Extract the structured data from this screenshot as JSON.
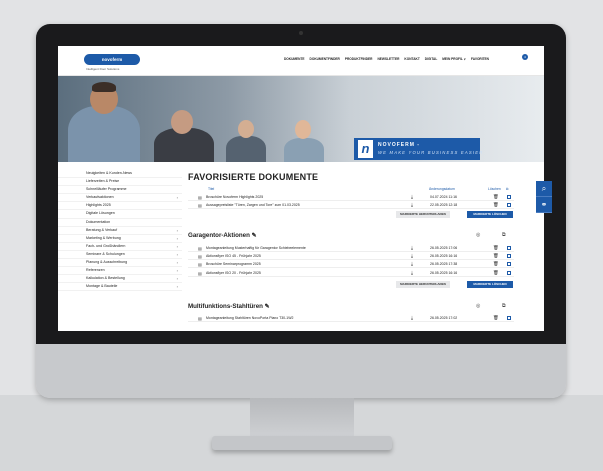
{
  "site": {
    "logo_text": "novoferm",
    "tagline": "Intelligent Door Solutions"
  },
  "nav": {
    "items": [
      "DOKUMENTE",
      "DOKUMENTFINDER",
      "PRODUKTFINDER",
      "NEWSLETTER",
      "KONTAKT",
      "DIGITAL",
      "MEIN PROFIL ∨",
      "FAVORITEN"
    ],
    "favorites_count": "4"
  },
  "hero": {
    "logo_letter": "n",
    "brand": "NOVOFERM -",
    "slogan": "WE MAKE YOUR BUSINESS EASIER"
  },
  "sidebar": {
    "items": [
      {
        "label": "Neuigkeiten & Kunden-News",
        "chev": ""
      },
      {
        "label": "Lieferzeiten & Preise",
        "chev": ""
      },
      {
        "label": "Schnellläufer Programme",
        "chev": ""
      },
      {
        "label": "Verkaufsaktionen",
        "chev": "›"
      },
      {
        "label": "Highlights 2025",
        "chev": ""
      },
      {
        "label": "Digitale Lösungen",
        "chev": ""
      },
      {
        "label": "Dokumentation",
        "chev": ""
      },
      {
        "label": "Beratung & Verkauf",
        "chev": "›"
      },
      {
        "label": "Marketing & Werbung",
        "chev": "›"
      },
      {
        "label": "Fach- und Großhändlern",
        "chev": "›"
      },
      {
        "label": "Seminare & Schulungen",
        "chev": "›"
      },
      {
        "label": "Planung & Ausschreibung",
        "chev": "›"
      },
      {
        "label": "Referenzen",
        "chev": "›"
      },
      {
        "label": "Kalkulation & Bestellung",
        "chev": "›"
      },
      {
        "label": "Montage & Bauteile",
        "chev": "›"
      }
    ]
  },
  "main": {
    "title": "FAVORISIERTE DOKUMENTE",
    "col_title": "Titel",
    "col_date": "Änderungsdatum",
    "col_delete": "Löschen",
    "btn_create_compilation": "MARKIERTE HERUNTERLADEN",
    "btn_delete_marked": "MARKIERTE LÖSCHEN",
    "rows_top": [
      {
        "title": "Broschüre Novoferm Highlights 2025",
        "date": "04.07.2024 11:16"
      },
      {
        "title": "Aussagepreisliste \"Türen, Zargen und Tore\" zum 01.03.2025",
        "date": "22.05.2025 12:18"
      }
    ],
    "sections": [
      {
        "title": "Garagentor-Aktionen",
        "rows": [
          {
            "title": "Montageanleitung Musterhaftig für Garagentor Schiebeelemente",
            "date": "26.05.2025 17:06"
          },
          {
            "title": "Aktionsflyer ISO 45 - Frühjahr 2025",
            "date": "26.05.2025 16:16"
          },
          {
            "title": "Broschüre Seminarprogramm 2025",
            "date": "26.05.2025 17:38"
          },
          {
            "title": "Aktionsflyer ISO 20 - Frühjahr 2025",
            "date": "26.05.2025 16:16"
          }
        ]
      },
      {
        "title": "Multifunktions-Stahltüren",
        "rows": [
          {
            "title": "Montageanleitung Stahltüren NovoPorta Piano T30-1W2",
            "date": "26.05.2025 17:02"
          }
        ]
      }
    ]
  },
  "colors": {
    "accent": "#1d5aa8",
    "bezel": "#1a1a1c"
  }
}
